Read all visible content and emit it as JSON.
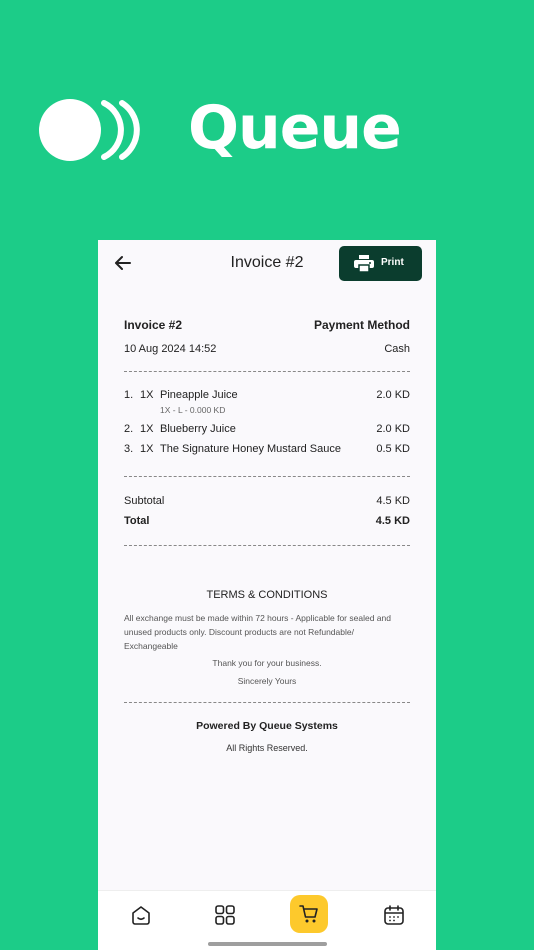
{
  "brand": {
    "name": "Queue",
    "logo_icon": "queue-logo-icon"
  },
  "header": {
    "title": "Invoice #2",
    "back_icon": "arrow-left-icon",
    "print_label": "Print",
    "print_icon": "printer-icon"
  },
  "invoice": {
    "number_label": "Invoice #2",
    "payment_method_label": "Payment Method",
    "datetime": "10 Aug 2024 14:52",
    "payment_method": "Cash",
    "items": [
      {
        "index": "1.",
        "qty": "1X",
        "name": "Pineapple Juice",
        "price": "2.0 KD",
        "modifier": "1X - L - 0.000 KD"
      },
      {
        "index": "2.",
        "qty": "1X",
        "name": "Blueberry Juice",
        "price": "2.0 KD"
      },
      {
        "index": "3.",
        "qty": "1X",
        "name": "The Signature Honey Mustard Sauce",
        "price": "0.5 KD"
      }
    ],
    "subtotal_label": "Subtotal",
    "subtotal": "4.5 KD",
    "total_label": "Total",
    "total": "4.5 KD"
  },
  "terms": {
    "title": "TERMS & CONDITIONS",
    "body": "All exchange must be made within 72 hours - Applicable for sealed and unused products only. Discount products are not Refundable/ Exchangeable",
    "thanks": "Thank you for your business.",
    "sign_off": "Sincerely Yours"
  },
  "footer": {
    "powered_by": "Powered By Queue Systems",
    "rights": "All Rights Reserved."
  },
  "tabbar": {
    "tabs": [
      "home-icon",
      "grid-icon",
      "cart-icon",
      "calendar-icon"
    ],
    "active": "cart-icon",
    "active_color": "#fdc92c"
  },
  "colors": {
    "background": "#1ccc88",
    "print_button": "#0b3d2e"
  }
}
